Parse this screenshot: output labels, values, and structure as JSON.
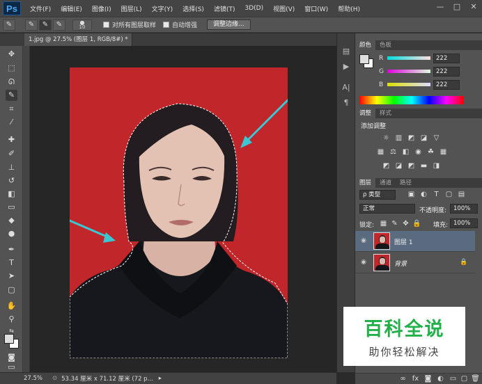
{
  "app": {
    "logo": "Ps",
    "menu": [
      "文件(F)",
      "编辑(E)",
      "图像(I)",
      "图层(L)",
      "文字(Y)",
      "选择(S)",
      "滤镜(T)",
      "3D(D)",
      "视图(V)",
      "窗口(W)",
      "帮助(H)"
    ],
    "window_controls": [
      "—",
      "□",
      "✕"
    ]
  },
  "options_bar": {
    "brush_size": "10",
    "sample_all_layers_label": "对所有图层取样",
    "auto_enhance_label": "自动增强",
    "refine_edge_label": "调整边缘..."
  },
  "document": {
    "tab_title": "1.jpg @ 27.5% (图层 1, RGB/8#) *",
    "tab_close": "×"
  },
  "status_bar": {
    "zoom": "27.5%",
    "doc_size": "53.34 厘米 x 71.12 厘米 (72 p..."
  },
  "color_panel": {
    "tabs": [
      "颜色",
      "色板"
    ],
    "r_label": "R",
    "g_label": "G",
    "b_label": "B",
    "r_value": "222",
    "g_value": "222",
    "b_value": "222",
    "foreground_color": "#dedede"
  },
  "adjustments_panel": {
    "tabs": [
      "调整",
      "样式"
    ],
    "heading": "添加调整"
  },
  "layers_panel": {
    "tabs": [
      "图层",
      "通道",
      "路径"
    ],
    "filter_label": "ρ 类型",
    "blend_mode": "正常",
    "opacity_label": "不透明度:",
    "opacity_value": "100%",
    "lock_label": "锁定:",
    "fill_label": "填充:",
    "fill_value": "100%",
    "layers": [
      {
        "name": "图层 1",
        "selected": true
      },
      {
        "name": "背景",
        "selected": false,
        "locked": true
      }
    ]
  },
  "watermark": {
    "title": "百科全说",
    "subtitle": "助你轻松解决",
    "color": "#23b04a"
  },
  "photo": {
    "background_color": "#c0262a"
  }
}
